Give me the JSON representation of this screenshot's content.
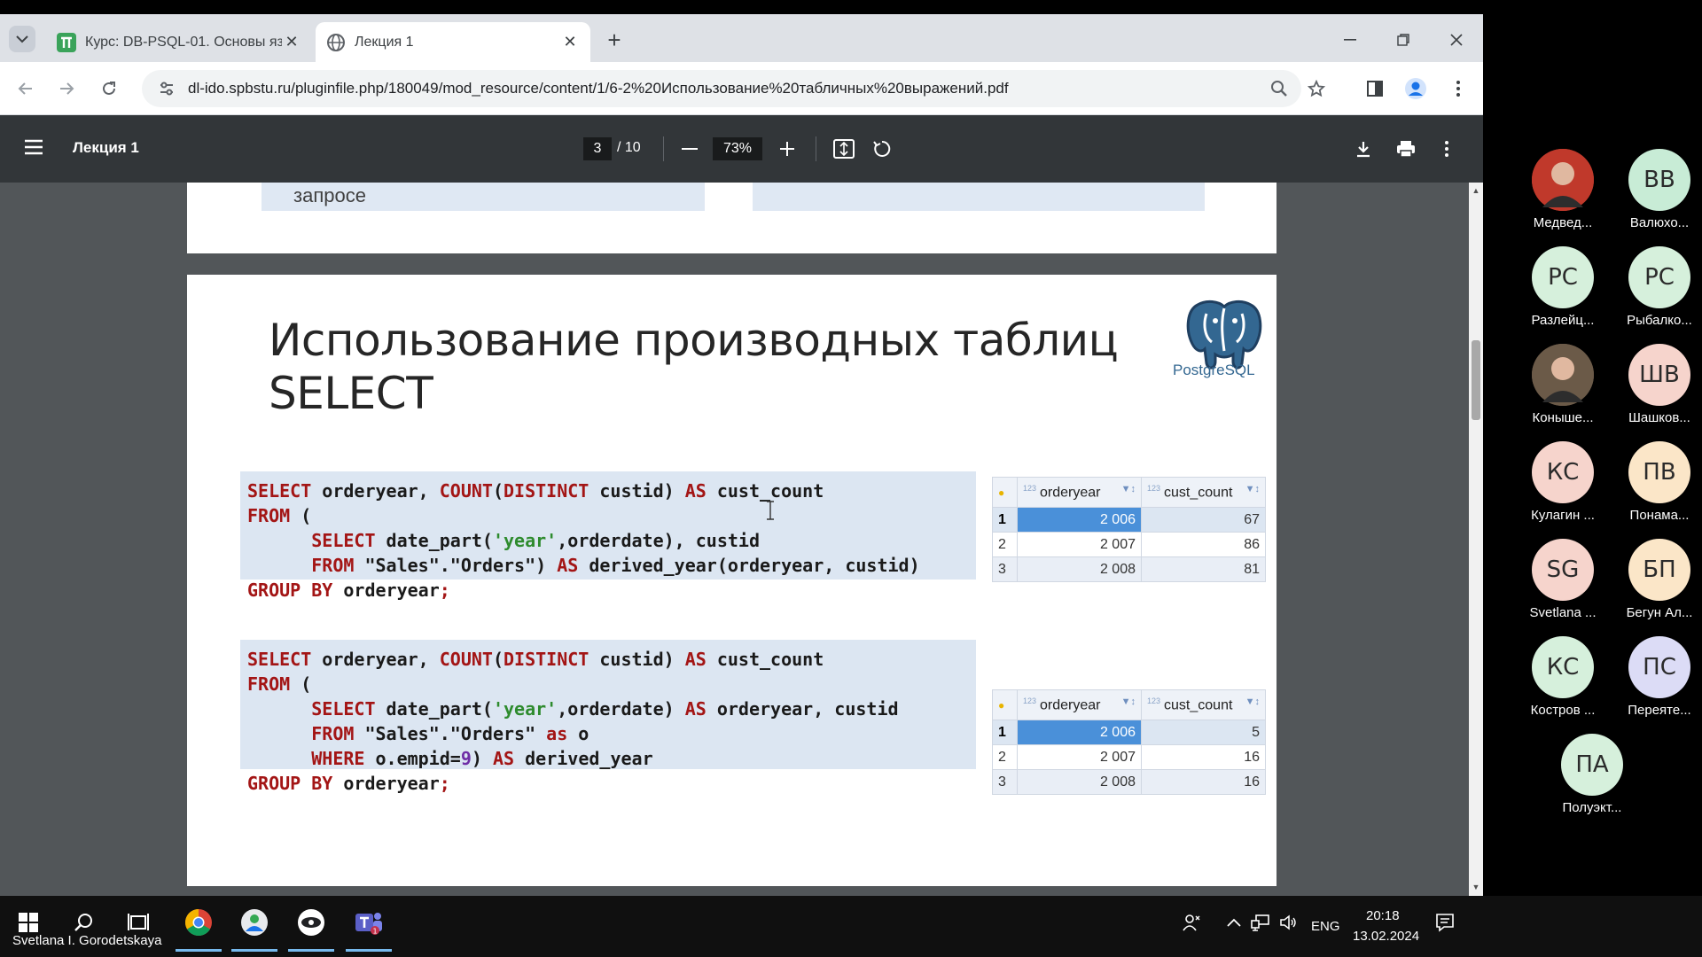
{
  "browser": {
    "tabs": [
      {
        "title": "Курс: DB-PSQL-01. Основы яз",
        "active": false
      },
      {
        "title": "Лекция 1",
        "active": true
      }
    ],
    "url": "dl-ido.spbstu.ru/pluginfile.php/180049/mod_resource/content/1/6-2%20Использование%20табличных%20выражений.pdf"
  },
  "pdf": {
    "title": "Лекция 1",
    "current_page": "3",
    "total_pages": "/ 10",
    "zoom": "73%"
  },
  "prev_page": {
    "text": "запросе"
  },
  "slide": {
    "title_line1": "Использование производных таблиц",
    "title_line2": "SELECT",
    "logo_text": "PostgreSQL",
    "query1": [
      "SELECT orderyear, COUNT(DISTINCT custid) AS cust_count",
      "FROM (",
      "      SELECT date_part('year',orderdate), custid",
      "      FROM \"Sales\".\"Orders\") AS derived_year(orderyear, custid)",
      "GROUP BY orderyear;"
    ],
    "query2": [
      "SELECT orderyear, COUNT(DISTINCT custid) AS cust_count",
      "FROM (",
      "      SELECT date_part('year',orderdate) AS orderyear, custid",
      "      FROM \"Sales\".\"Orders\" as o",
      "      WHERE o.empid=9) AS derived_year",
      "GROUP BY orderyear;"
    ],
    "table1": {
      "columns": [
        "orderyear",
        "cust_count"
      ],
      "rows": [
        {
          "n": "1",
          "year": "2 006",
          "count": "67"
        },
        {
          "n": "2",
          "year": "2 007",
          "count": "86"
        },
        {
          "n": "3",
          "year": "2 008",
          "count": "81"
        }
      ]
    },
    "table2": {
      "columns": [
        "orderyear",
        "cust_count"
      ],
      "rows": [
        {
          "n": "1",
          "year": "2 006",
          "count": "5"
        },
        {
          "n": "2",
          "year": "2 007",
          "count": "16"
        },
        {
          "n": "3",
          "year": "2 008",
          "count": "16"
        }
      ]
    }
  },
  "participants": [
    {
      "initials": "",
      "name": "Медвед...",
      "color": "#c0392b",
      "photo": true
    },
    {
      "initials": "ВВ",
      "name": "Валюхо...",
      "color": "#c8ecd6"
    },
    {
      "initials": "РС",
      "name": "Разлейц...",
      "color": "#d6f0dc"
    },
    {
      "initials": "РС",
      "name": "Рыбалко...",
      "color": "#d6f0dc"
    },
    {
      "initials": "",
      "name": "Коныше...",
      "color": "#6b5a48",
      "photo": true
    },
    {
      "initials": "ШВ",
      "name": "Шашков...",
      "color": "#f6d4cc"
    },
    {
      "initials": "КС",
      "name": "Кулагин ...",
      "color": "#f6d4cc"
    },
    {
      "initials": "ПВ",
      "name": "Понама...",
      "color": "#fbe6c8"
    },
    {
      "initials": "SG",
      "name": "Svetlana ...",
      "color": "#f6d4cc"
    },
    {
      "initials": "БП",
      "name": "Бегун Ал...",
      "color": "#fbe6c8"
    },
    {
      "initials": "КС",
      "name": "Костров ...",
      "color": "#d6f0dc"
    },
    {
      "initials": "ПС",
      "name": "Переяте...",
      "color": "#dcdcf6"
    },
    {
      "initials": "ПА",
      "name": "Полуэкт...",
      "color": "#d6f0dc"
    }
  ],
  "taskbar": {
    "user": "Svetlana I. Gorodetskaya",
    "language": "ENG",
    "time": "20:18",
    "date": "13.02.2024"
  }
}
